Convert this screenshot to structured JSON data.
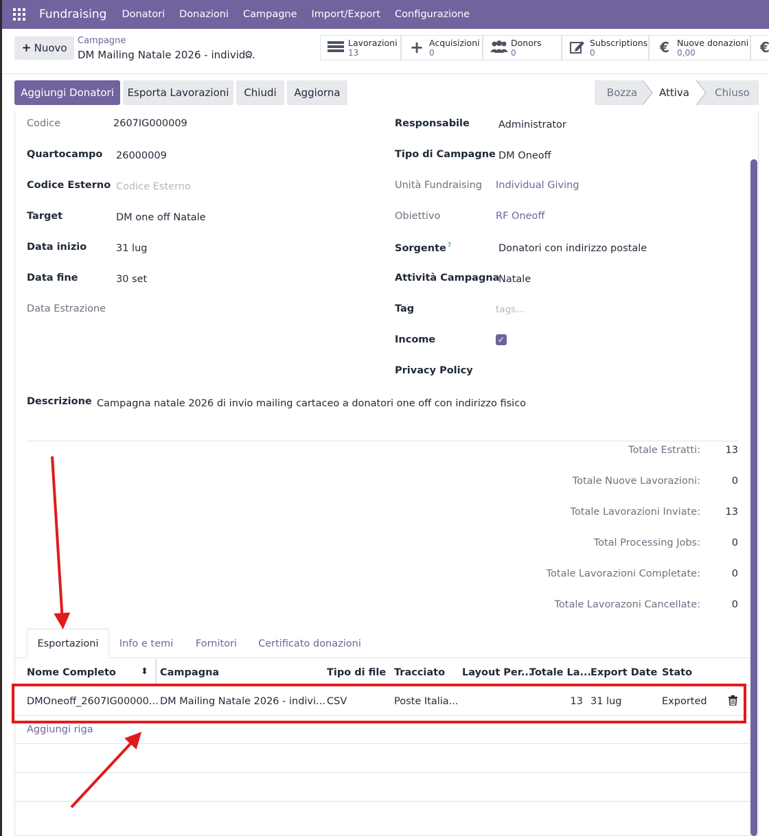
{
  "navbar": {
    "app_name": "Fundraising",
    "menu": [
      "Donatori",
      "Donazioni",
      "Campagne",
      "Import/Export",
      "Configurazione"
    ]
  },
  "control_panel": {
    "new_button": "Nuovo",
    "breadcrumb_parent": "Campagne",
    "breadcrumb_current": "DM Mailing Natale 2026 - individ...",
    "smart_buttons": [
      {
        "label": "Lavorazioni",
        "value": "13",
        "icon": "list-icon"
      },
      {
        "label": "Acquisizioni",
        "value": "0",
        "icon": "plus-icon"
      },
      {
        "label": "Donors",
        "value": "0",
        "icon": "users-icon"
      },
      {
        "label": "Subscriptions",
        "value": "0",
        "icon": "edit-icon"
      },
      {
        "label": "Nuove donazioni",
        "value": "0,00",
        "icon": "euro-icon"
      },
      {
        "label": "",
        "value": "",
        "icon": "euro-icon"
      }
    ]
  },
  "statusbar": {
    "buttons": [
      "Aggiungi Donatori",
      "Esporta Lavorazioni",
      "Chiudi",
      "Aggiorna"
    ],
    "stages": [
      "Bozza",
      "Attiva",
      "Chiuso"
    ],
    "active_stage": "Attiva"
  },
  "form": {
    "codice_label": "Codice",
    "codice_value": "2607IG000009",
    "quartocampo_label": "Quartocampo",
    "quartocampo_value": "26000009",
    "codice_esterno_label": "Codice Esterno",
    "codice_esterno_placeholder": "Codice Esterno",
    "target_label": "Target",
    "target_value": "DM one off Natale",
    "data_inizio_label": "Data inizio",
    "data_inizio_value": "31 lug",
    "data_fine_label": "Data fine",
    "data_fine_value": "30 set",
    "data_estrazione_label": "Data Estrazione",
    "responsabile_label": "Responsabile",
    "responsabile_value": "Administrator",
    "tipo_label": "Tipo di Campagne",
    "tipo_value": "DM Oneoff",
    "unita_label": "Unità Fundraising",
    "unita_value": "Individual Giving",
    "obiettivo_label": "Obiettivo",
    "obiettivo_value": "RF Oneoff",
    "sorgente_label": "Sorgente",
    "sorgente_help": "?",
    "sorgente_value": "Donatori con indirizzo postale",
    "attivita_label": "Attività Campagna",
    "attivita_value": "Natale",
    "tag_label": "Tag",
    "tag_placeholder": "tags...",
    "income_label": "Income",
    "income_checked": true,
    "privacy_label": "Privacy Policy",
    "descrizione_label": "Descrizione",
    "descrizione_value": "Campagna natale 2026 di invio mailing cartaceo a donatori one off con indirizzo fisico"
  },
  "totals": [
    {
      "label": "Totale Estratti:",
      "value": "13"
    },
    {
      "label": "Totale Nuove Lavorazioni:",
      "value": "0"
    },
    {
      "label": "Totale Lavorazioni Inviate:",
      "value": "13"
    },
    {
      "label": "Total Processing Jobs:",
      "value": "0"
    },
    {
      "label": "Totale Lavorazioni Completate:",
      "value": "0"
    },
    {
      "label": "Totale Lavorazoni Cancellate:",
      "value": "0"
    }
  ],
  "tabs": [
    "Esportazioni",
    "Info e temi",
    "Fornitori",
    "Certificato donazioni"
  ],
  "list": {
    "columns": [
      "Nome Completo",
      "Campagna",
      "Tipo di file",
      "Tracciato",
      "Layout Per...",
      "Totale La...",
      "Export Date",
      "Stato"
    ],
    "row": {
      "nome": "DMOneoff_2607IG00000...",
      "campagna": "DM Mailing Natale 2026 - indivi...",
      "tipo_file": "CSV",
      "tracciato": "Poste Italia...",
      "layout": "",
      "totale": "13",
      "export_date": "31 lug",
      "stato": "Exported"
    },
    "add_line": "Aggiungi riga"
  },
  "colors": {
    "brand": "#71639e",
    "annotation": "#e01b1b"
  }
}
